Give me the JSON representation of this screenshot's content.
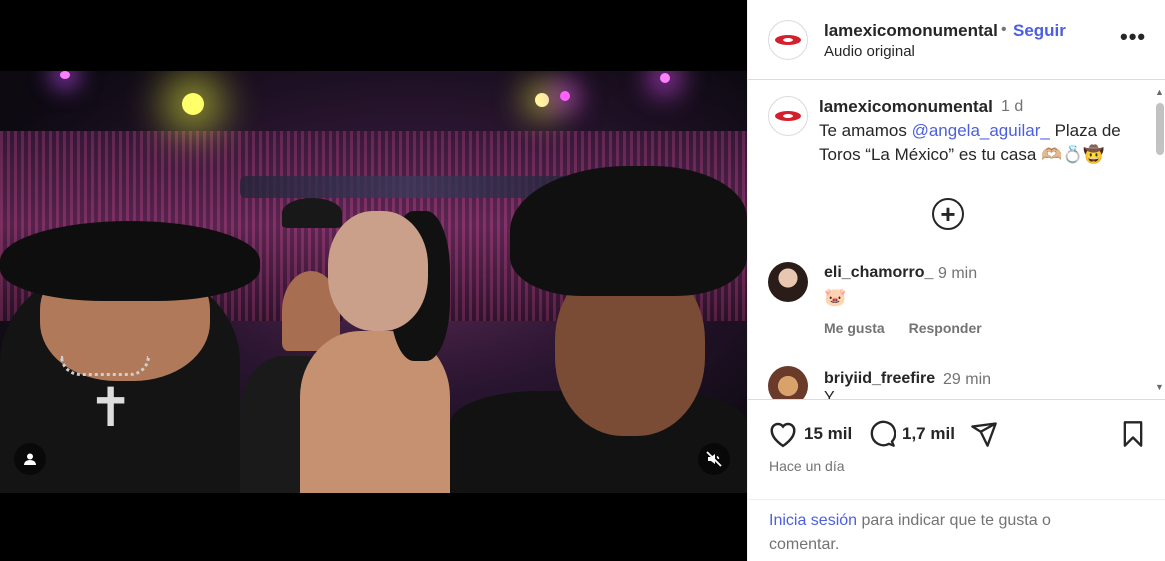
{
  "header": {
    "username": "lamexicomonumental",
    "separator": "•",
    "follow_label": "Seguir",
    "audio": "Audio original",
    "more_icon": "more-horizontal-icon"
  },
  "caption": {
    "username": "lamexicomonumental",
    "time": "1 d",
    "text_before": "Te amamos ",
    "mention": "@angela_aguilar_",
    "text_after": " Plaza de Toros “La México” es tu casa 🫶🏼💍🤠"
  },
  "load_more_icon": "plus-circle-icon",
  "comments": [
    {
      "username": "eli_chamorro_",
      "time": "9 min",
      "text": "🐷",
      "like_label": "Me gusta",
      "reply_label": "Responder"
    },
    {
      "username": "briyiid_freefire",
      "time": "29 min",
      "text": "Y ..."
    }
  ],
  "actions": {
    "likes": "15 mil",
    "comments": "1,7 mil",
    "posted": "Hace un día"
  },
  "footer": {
    "login_link": "Inicia sesión",
    "login_text": " para indicar que te gusta o comentar."
  },
  "colors": {
    "accent": "#4b5fe0",
    "muted": "#737373",
    "text": "#262626"
  }
}
